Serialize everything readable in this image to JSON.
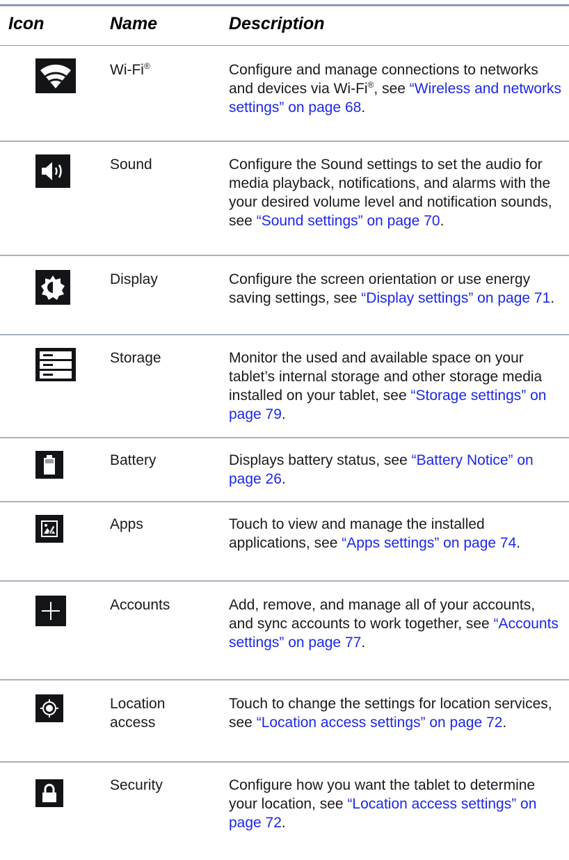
{
  "headers": {
    "icon": "Icon",
    "name": "Name",
    "description": "Description"
  },
  "rows": [
    {
      "icon": "wifi-icon",
      "name": "Wi-Fi",
      "name_sup": "®",
      "desc_a": "Configure and manage connections to networks and devices via Wi-Fi",
      "desc_sup": "®",
      "desc_b": ", see ",
      "link": "“Wireless and networks settings” on page 68",
      "desc_end": "."
    },
    {
      "icon": "sound-icon",
      "name": "Sound",
      "desc_a": "Configure the Sound settings to set the audio for media playback, notifications, and alarms with the your desired volume level and notification sounds, see ",
      "link": "“Sound settings” on page 70",
      "desc_end": "."
    },
    {
      "icon": "display-brightness-icon",
      "name": "Display",
      "desc_a": "Configure the screen orientation or use energy saving settings, see ",
      "link": "“Display settings” on page 71",
      "desc_end": "."
    },
    {
      "icon": "storage-icon",
      "name": "Storage",
      "desc_a": "Monitor the used and available space on your tablet’s internal storage and other storage media installed on your tablet, see ",
      "link": "“Storage settings” on page 79",
      "desc_end": "."
    },
    {
      "icon": "battery-icon",
      "name": "Battery",
      "desc_a": "Displays battery status, see ",
      "link": "“Battery Notice” on page 26",
      "desc_end": "."
    },
    {
      "icon": "apps-icon",
      "name": "Apps",
      "desc_a": "Touch to view and manage the installed applications, see ",
      "link": "“Apps settings” on page 74",
      "desc_end": "."
    },
    {
      "icon": "add-account-icon",
      "name": "Accounts",
      "desc_a": "Add, remove, and manage all of your accounts, and sync accounts to work together, see ",
      "link": "“Accounts settings” on page 77",
      "desc_end": "."
    },
    {
      "icon": "location-icon",
      "name": "Location access",
      "desc_a": "Touch to change the settings for location services, see ",
      "link": "“Location access settings” on page 72",
      "desc_end": "."
    },
    {
      "icon": "lock-icon",
      "name": "Security",
      "desc_a": "Configure how you want the tablet to determine your location, see ",
      "link": "“Location access settings” on page 72",
      "desc_end": "."
    }
  ]
}
